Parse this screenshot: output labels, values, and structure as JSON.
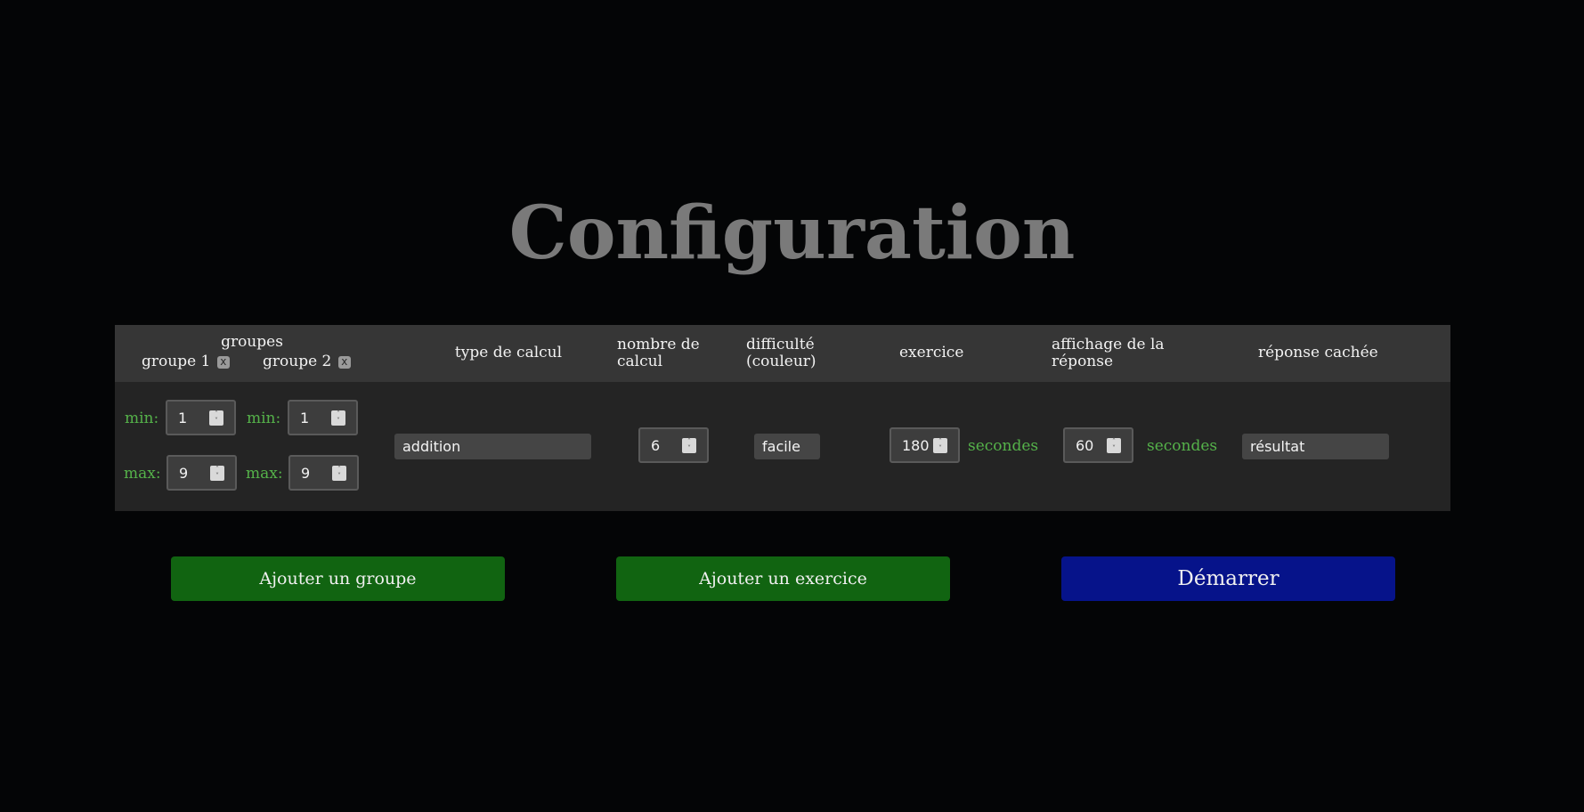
{
  "page": {
    "title": "Configuration"
  },
  "table": {
    "headers": {
      "groupes": "groupes",
      "groupe1": "groupe 1",
      "groupe2": "groupe 2",
      "remove_label": "x",
      "type_calcul": "type de calcul",
      "nombre_calcul_line1": "nombre de",
      "nombre_calcul_line2": "calcul",
      "difficulte_line1": "difficulté",
      "difficulte_line2": "(couleur)",
      "exercice": "exercice",
      "affichage_line1": "affichage de la",
      "affichage_line2": "réponse",
      "reponse_cachee": "réponse cachée"
    },
    "row": {
      "min_label": "min:",
      "max_label": "max:",
      "groupe1_min": "1",
      "groupe1_max": "9",
      "groupe2_min": "1",
      "groupe2_max": "9",
      "type_calcul": "addition",
      "nombre_calcul": "6",
      "difficulte": "facile",
      "exercice_seconds": "180",
      "exercice_unit": "secondes",
      "affichage_seconds": "60",
      "affichage_unit": "secondes",
      "reponse_cachee": "résultat"
    }
  },
  "buttons": {
    "add_group": "Ajouter un groupe",
    "add_exercise": "Ajouter un exercice",
    "start": "Démarrer"
  },
  "colors": {
    "background": "#040506",
    "title": "#7a7a7a",
    "header_bg": "#363636",
    "row_bg": "#242424",
    "label_green": "#55b24a",
    "add_button": "#116411",
    "start_button": "#06138a"
  },
  "icons": {
    "spinner": "spinner-arrows-icon",
    "remove": "close-icon"
  }
}
